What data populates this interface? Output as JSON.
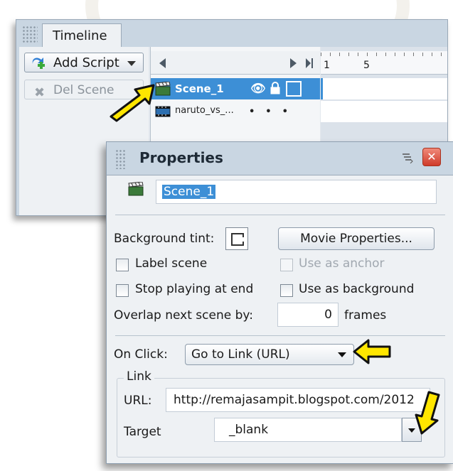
{
  "timeline": {
    "title": "Timeline",
    "add_script_label": "Add Script",
    "del_scene_label": "Del Scene",
    "layers": [
      {
        "name": "Scene_1",
        "selected": true
      },
      {
        "name": "naruto_vs_...",
        "selected": false
      }
    ],
    "ruler": {
      "first": "1",
      "fifth": "5"
    }
  },
  "properties": {
    "title": "Properties",
    "scene_name": "Scene_1",
    "background_tint_label": "Background tint:",
    "movie_properties_label": "Movie Properties...",
    "label_scene_label": "Label scene",
    "use_as_anchor_label": "Use as anchor",
    "stop_playing_label": "Stop playing at end",
    "use_as_background_label": "Use as background",
    "overlap_label": "Overlap next scene by:",
    "overlap_value": "0",
    "frames_label": "frames",
    "on_click_label": "On Click:",
    "on_click_value": "Go to Link (URL)",
    "link_group_label": "Link",
    "url_label": "URL:",
    "url_value": "http://remajasampit.blogspot.com/2012",
    "target_label": "Target",
    "target_value": "_blank"
  },
  "colors": {
    "selection": "#3d8fd6",
    "panel_header": "#c9d6e2",
    "annotation_arrow": "#ffe600"
  },
  "icons": [
    "film-clapper-icon",
    "film-strip-icon",
    "eye-icon",
    "lock-icon",
    "plus-script-icon",
    "close-icon",
    "panel-menu-icon"
  ]
}
